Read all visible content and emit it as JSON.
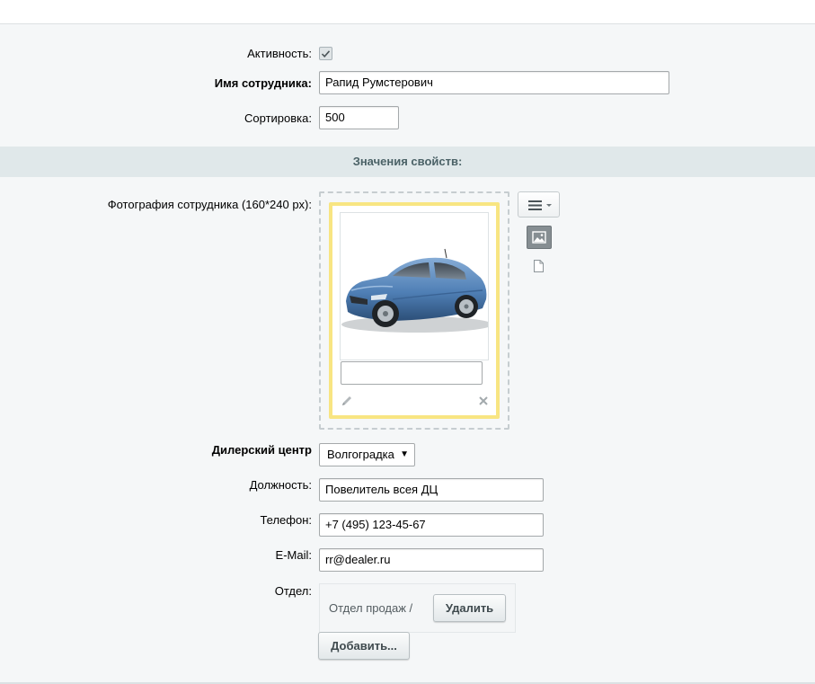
{
  "form": {
    "activity_label": "Активность:",
    "activity_checked": true,
    "name_label": "Имя сотрудника:",
    "name_value": "Рапид Румстерович",
    "sort_label": "Сортировка:",
    "sort_value": "500"
  },
  "section": {
    "title": "Значения свойств:"
  },
  "properties": {
    "photo_label": "Фотография сотрудника (160*240 px):",
    "photo_description_value": "",
    "dealer_label": "Дилерский центр",
    "dealer_selected": "Волгоградка",
    "position_label": "Должность:",
    "position_value": "Повелитель всея ДЦ",
    "phone_label": "Телефон:",
    "phone_value": "+7 (495) 123-45-67",
    "email_label": "E-Mail:",
    "email_value": "rr@dealer.ru",
    "department_label": "Отдел:",
    "department_value": "Отдел продаж /",
    "delete_label": "Удалить",
    "add_label": "Добавить..."
  },
  "icons": {
    "menu": "hamburger-menu-icon",
    "image_mode": "image-icon",
    "file_mode": "file-icon",
    "edit": "pencil-icon",
    "remove": "close-icon"
  },
  "colors": {
    "photo_border": "#f8e582",
    "section_bg": "#e0e8ea",
    "section_text": "#4b6267",
    "page_bg": "#f5f7f8"
  }
}
